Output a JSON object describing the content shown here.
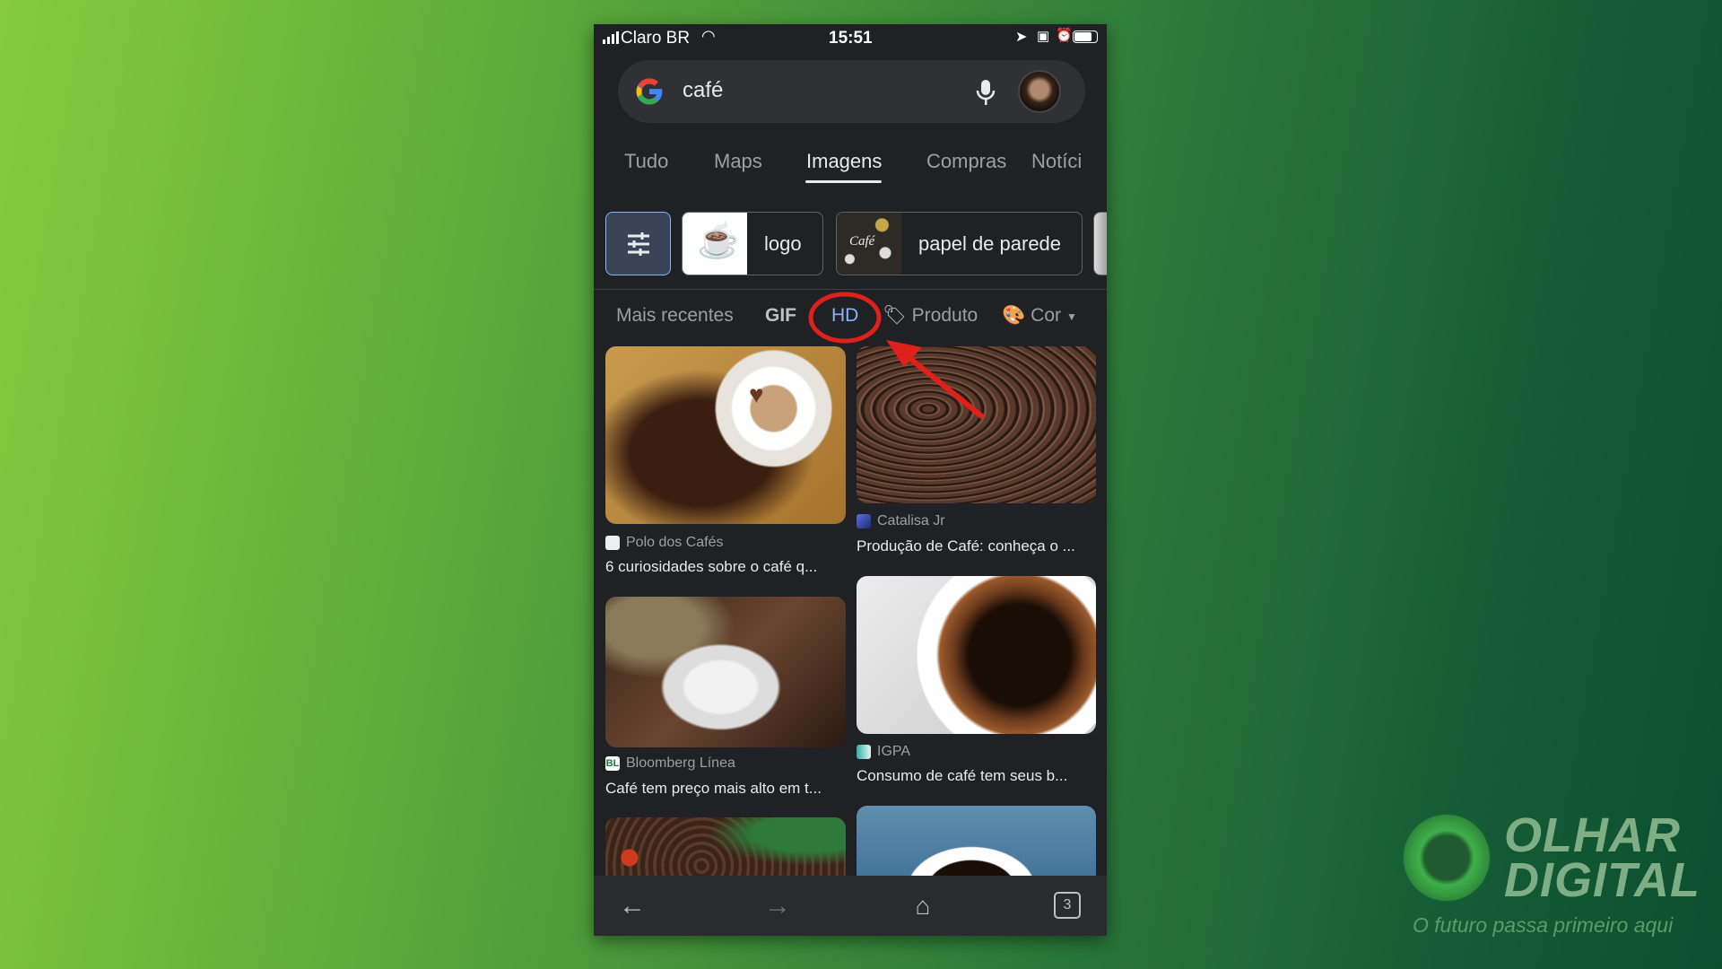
{
  "status_bar": {
    "carrier": "Claro BR",
    "time": "15:51"
  },
  "search": {
    "query": "café"
  },
  "tabs": [
    {
      "label": "Tudo"
    },
    {
      "label": "Maps"
    },
    {
      "label": "Imagens",
      "active": true
    },
    {
      "label": "Compras"
    },
    {
      "label": "Notíci"
    }
  ],
  "chips": [
    {
      "label": "logo"
    },
    {
      "label": "papel de parede"
    }
  ],
  "chip_thumb_text": "Café",
  "filters": {
    "recent": "Mais recentes",
    "gif": "GIF",
    "hd": "HD",
    "product": "Produto",
    "color": "Cor"
  },
  "results": [
    {
      "source": "Polo dos Cafés",
      "title": "6 curiosidades sobre o café q..."
    },
    {
      "source": "Catalisa Jr",
      "title": "Produção de Café: conheça o ..."
    },
    {
      "source": "Bloomberg Línea",
      "title": "Café tem preço mais alto em t..."
    },
    {
      "source": "IGPA",
      "title": "Consumo de café tem seus b..."
    }
  ],
  "bottom_nav": {
    "tab_count": "3"
  },
  "watermark": {
    "brand_line1": "OLHAR",
    "brand_line2": "DIGITAL",
    "tagline": "O futuro passa primeiro aqui"
  },
  "colors": {
    "highlight": "#e0201b",
    "hd_active": "#8ab4f8",
    "background": "#202124"
  }
}
